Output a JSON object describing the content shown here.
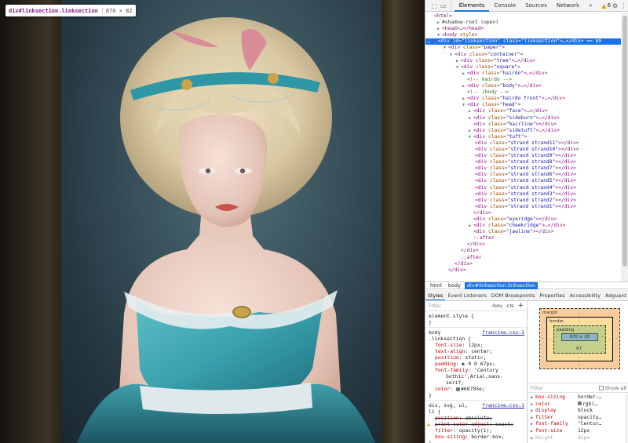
{
  "tooltip": {
    "selector": "div#linksection.linksection",
    "dimensions": "870 × 82"
  },
  "toolbar": {
    "tabs": [
      "Elements",
      "Console",
      "Sources",
      "Network"
    ],
    "more": "»",
    "warnings": "6",
    "icons": [
      "inspect-icon",
      "device-toolbar-icon",
      "settings-icon",
      "kebab-menu-icon"
    ]
  },
  "dom": {
    "l01": "<html>",
    "l02": "#shadow-root (open)",
    "l03a": "<head>",
    "l03b": "…",
    "l03c": "</head>",
    "l04a": "<body ",
    "l04b": "style",
    "l04c": ">",
    "sel_prefix": "…",
    "sel_tag": "<div ",
    "sel_id_attr": "id=",
    "sel_id_val": "\"linksection\"",
    "sel_class_attr": " class=",
    "sel_class_val": "\"linksection\"",
    "sel_end": ">…</div>",
    "sel_eq": " == $0",
    "paper": "\"paper\"",
    "container": "\"container\"",
    "tree": "\"tree\"",
    "square": "\"square\"",
    "hairdo": "\"hairdo\"",
    "c_hairdo": "<!-- hairdo -->",
    "body_cls": "\"body\"",
    "c_body": "<!-- /body -->",
    "hairdo_front": "\"hairdo front\"",
    "head": "\"head\"",
    "face": "\"face\"",
    "sideburn": "\"sideburn\"",
    "hairline": "\"hairline\"",
    "sidetuft": "\"sidetuft\"",
    "tuft": "\"tuft\"",
    "strands": [
      "\"strand strand11\"",
      "\"strand strand10\"",
      "\"strand strand9\"",
      "\"strand strand8\"",
      "\"strand strand7\"",
      "\"strand strand6\"",
      "\"strand strand5\"",
      "\"strand strand4\"",
      "\"strand strand3\"",
      "\"strand strand2\"",
      "\"strand strand1\""
    ],
    "eyeridge": "\"eyeridge\"",
    "cheekridge": "\"cheekridge\"",
    "jawline": "\"jawline\"",
    "after": "::after",
    "close_div": "</div>",
    "div_open": "<div ",
    "class_attr": "class=",
    "ellipsis_close": ">…</div>",
    "close_empty": "></div>",
    "gt": ">"
  },
  "breadcrumb": [
    "html",
    "body",
    "div#linksection.linksection"
  ],
  "subtabs": [
    "Styles",
    "Event Listeners",
    "DOM Breakpoints",
    "Properties",
    "Accessibility",
    "Adguard"
  ],
  "styles": {
    "filter_placeholder": "Filter",
    "hov": ":hov",
    "cls": ".cls",
    "plus": "+",
    "element_style": "element.style {",
    "close_brace": "}",
    "rule1_selector_a": "body",
    "rule1_selector_b": ".linksection {",
    "rule1_source": "francine.css:1",
    "rule1_props": [
      {
        "name": "font-size",
        "value": "12px;"
      },
      {
        "name": "text-align",
        "value": "center;"
      },
      {
        "name": "position",
        "value": "static;"
      },
      {
        "name": "padding",
        "value": "▶ 0 0 67px;"
      },
      {
        "name": "font-family",
        "value": "'Century"
      },
      {
        "name": "",
        "value": "Gothic',Arial,sans-"
      },
      {
        "name": "",
        "value": "serif;"
      },
      {
        "name": "color",
        "value": "#68705e;"
      }
    ],
    "rule2_selector_a": "div, svg, ul,",
    "rule2_selector_b": "li {",
    "rule2_source": "francine.css:1",
    "rule2_props": [
      {
        "name": "position",
        "value": "absolute;"
      },
      {
        "name": "print-color-adjust",
        "value": "exact;"
      },
      {
        "name": "filter",
        "value": "opacity(1);"
      },
      {
        "name": "box-sizing",
        "value": "border-box;"
      }
    ]
  },
  "boxmodel": {
    "margin_label": "margin",
    "border_label": "border",
    "padding_label": "padding",
    "dash": "–",
    "content": "870 × 15",
    "padding_bottom": "67",
    "padding_left": "–",
    "padding_right": "–"
  },
  "computed": {
    "filter_placeholder": "Filter",
    "show_all": "Show all",
    "props": [
      {
        "name": "box-sizing",
        "value": "border-…"
      },
      {
        "name": "color",
        "value": "rgb(…"
      },
      {
        "name": "display",
        "value": "block"
      },
      {
        "name": "filter",
        "value": "opacity…"
      },
      {
        "name": "font-family",
        "value": "\"Centur…"
      },
      {
        "name": "font-size",
        "value": "12px"
      },
      {
        "name": "height",
        "value": "82px"
      }
    ]
  },
  "colors": {
    "accent": "#1a73e8",
    "tag": "#881280",
    "attr": "#994500",
    "value": "#1a1aa6",
    "comment": "#236e25",
    "prop": "#c80000",
    "color_swatch": "#68705e"
  }
}
